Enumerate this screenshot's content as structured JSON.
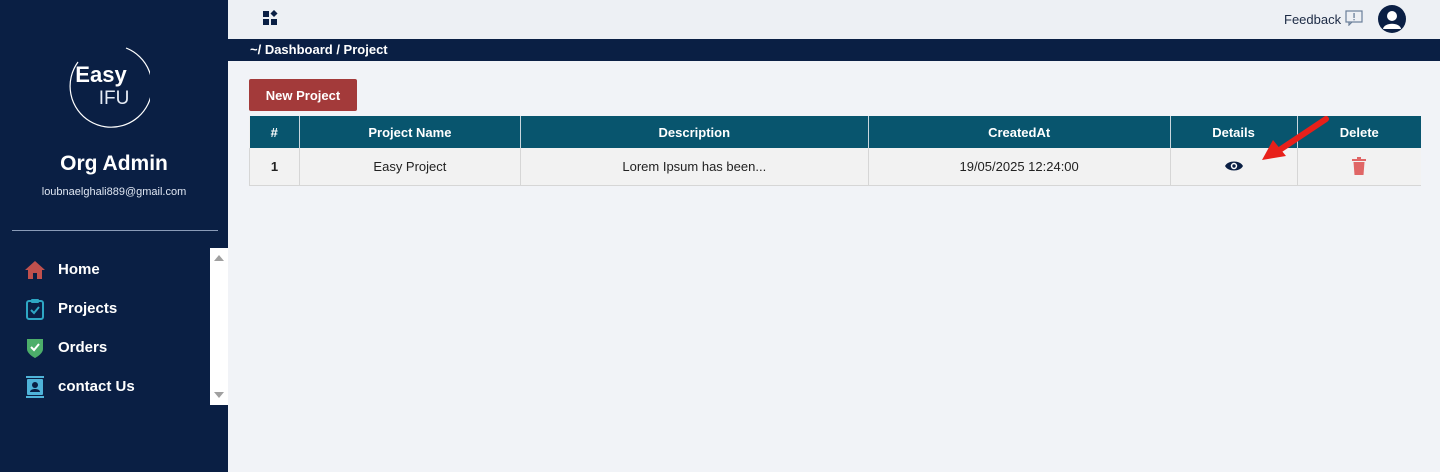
{
  "sidebar": {
    "logo": {
      "line1": "Easy",
      "line2": "IFU"
    },
    "user": {
      "name": "Org Admin",
      "email": "loubnaelghali889@gmail.com"
    },
    "items": [
      {
        "label": "Home",
        "icon": "home-icon",
        "color": "#c0504d"
      },
      {
        "label": "Projects",
        "icon": "clipboard-check-icon",
        "color": "#2ea7c4"
      },
      {
        "label": "Orders",
        "icon": "shield-check-icon",
        "color": "#4cae6a"
      },
      {
        "label": "contact Us",
        "icon": "contact-card-icon",
        "color": "#4fb3d9"
      }
    ]
  },
  "topbar": {
    "apps_icon": "grid-icon",
    "feedback_label": "Feedback",
    "feedback_icon": "feedback-icon",
    "avatar_icon": "user-avatar-icon"
  },
  "breadcrumb": "~/ Dashboard / Project",
  "new_project_label": "New Project",
  "table": {
    "headers": [
      "#",
      "Project Name",
      "Description",
      "CreatedAt",
      "Details",
      "Delete"
    ],
    "rows": [
      {
        "index": "1",
        "name": "Easy Project",
        "description": "Lorem Ipsum has been...",
        "created_at": "19/05/2025 12:24:00",
        "details_icon": "eye-icon",
        "delete_icon": "trash-icon"
      }
    ]
  },
  "colors": {
    "sidebar_bg": "#0a1f44",
    "header_bg": "#08556e",
    "new_button_bg": "#a33a3a",
    "delete_icon": "#e06666",
    "annotation_arrow": "#e8201a"
  }
}
